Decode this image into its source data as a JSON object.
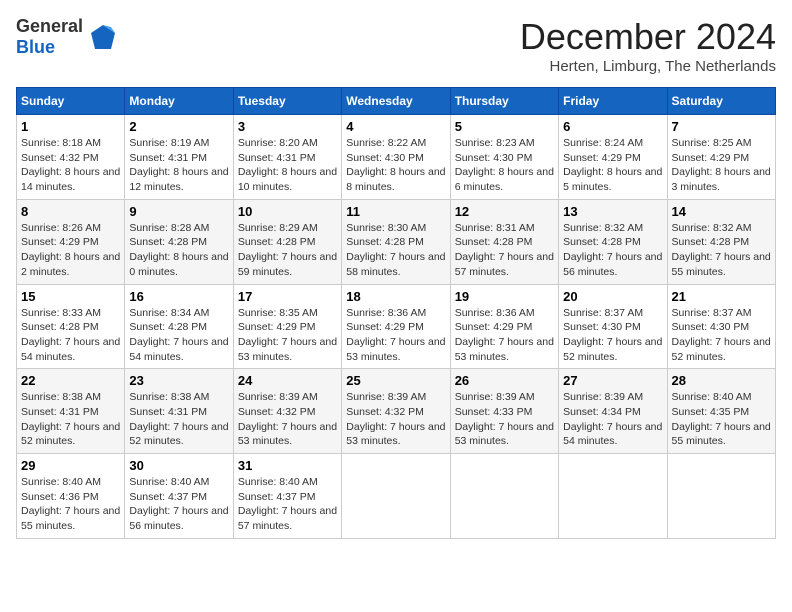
{
  "header": {
    "logo_general": "General",
    "logo_blue": "Blue",
    "month_year": "December 2024",
    "location": "Herten, Limburg, The Netherlands"
  },
  "weekdays": [
    "Sunday",
    "Monday",
    "Tuesday",
    "Wednesday",
    "Thursday",
    "Friday",
    "Saturday"
  ],
  "weeks": [
    [
      {
        "day": "1",
        "sunrise": "8:18 AM",
        "sunset": "4:32 PM",
        "daylight": "8 hours and 14 minutes."
      },
      {
        "day": "2",
        "sunrise": "8:19 AM",
        "sunset": "4:31 PM",
        "daylight": "8 hours and 12 minutes."
      },
      {
        "day": "3",
        "sunrise": "8:20 AM",
        "sunset": "4:31 PM",
        "daylight": "8 hours and 10 minutes."
      },
      {
        "day": "4",
        "sunrise": "8:22 AM",
        "sunset": "4:30 PM",
        "daylight": "8 hours and 8 minutes."
      },
      {
        "day": "5",
        "sunrise": "8:23 AM",
        "sunset": "4:30 PM",
        "daylight": "8 hours and 6 minutes."
      },
      {
        "day": "6",
        "sunrise": "8:24 AM",
        "sunset": "4:29 PM",
        "daylight": "8 hours and 5 minutes."
      },
      {
        "day": "7",
        "sunrise": "8:25 AM",
        "sunset": "4:29 PM",
        "daylight": "8 hours and 3 minutes."
      }
    ],
    [
      {
        "day": "8",
        "sunrise": "8:26 AM",
        "sunset": "4:29 PM",
        "daylight": "8 hours and 2 minutes."
      },
      {
        "day": "9",
        "sunrise": "8:28 AM",
        "sunset": "4:28 PM",
        "daylight": "8 hours and 0 minutes."
      },
      {
        "day": "10",
        "sunrise": "8:29 AM",
        "sunset": "4:28 PM",
        "daylight": "7 hours and 59 minutes."
      },
      {
        "day": "11",
        "sunrise": "8:30 AM",
        "sunset": "4:28 PM",
        "daylight": "7 hours and 58 minutes."
      },
      {
        "day": "12",
        "sunrise": "8:31 AM",
        "sunset": "4:28 PM",
        "daylight": "7 hours and 57 minutes."
      },
      {
        "day": "13",
        "sunrise": "8:32 AM",
        "sunset": "4:28 PM",
        "daylight": "7 hours and 56 minutes."
      },
      {
        "day": "14",
        "sunrise": "8:32 AM",
        "sunset": "4:28 PM",
        "daylight": "7 hours and 55 minutes."
      }
    ],
    [
      {
        "day": "15",
        "sunrise": "8:33 AM",
        "sunset": "4:28 PM",
        "daylight": "7 hours and 54 minutes."
      },
      {
        "day": "16",
        "sunrise": "8:34 AM",
        "sunset": "4:28 PM",
        "daylight": "7 hours and 54 minutes."
      },
      {
        "day": "17",
        "sunrise": "8:35 AM",
        "sunset": "4:29 PM",
        "daylight": "7 hours and 53 minutes."
      },
      {
        "day": "18",
        "sunrise": "8:36 AM",
        "sunset": "4:29 PM",
        "daylight": "7 hours and 53 minutes."
      },
      {
        "day": "19",
        "sunrise": "8:36 AM",
        "sunset": "4:29 PM",
        "daylight": "7 hours and 53 minutes."
      },
      {
        "day": "20",
        "sunrise": "8:37 AM",
        "sunset": "4:30 PM",
        "daylight": "7 hours and 52 minutes."
      },
      {
        "day": "21",
        "sunrise": "8:37 AM",
        "sunset": "4:30 PM",
        "daylight": "7 hours and 52 minutes."
      }
    ],
    [
      {
        "day": "22",
        "sunrise": "8:38 AM",
        "sunset": "4:31 PM",
        "daylight": "7 hours and 52 minutes."
      },
      {
        "day": "23",
        "sunrise": "8:38 AM",
        "sunset": "4:31 PM",
        "daylight": "7 hours and 52 minutes."
      },
      {
        "day": "24",
        "sunrise": "8:39 AM",
        "sunset": "4:32 PM",
        "daylight": "7 hours and 53 minutes."
      },
      {
        "day": "25",
        "sunrise": "8:39 AM",
        "sunset": "4:32 PM",
        "daylight": "7 hours and 53 minutes."
      },
      {
        "day": "26",
        "sunrise": "8:39 AM",
        "sunset": "4:33 PM",
        "daylight": "7 hours and 53 minutes."
      },
      {
        "day": "27",
        "sunrise": "8:39 AM",
        "sunset": "4:34 PM",
        "daylight": "7 hours and 54 minutes."
      },
      {
        "day": "28",
        "sunrise": "8:40 AM",
        "sunset": "4:35 PM",
        "daylight": "7 hours and 55 minutes."
      }
    ],
    [
      {
        "day": "29",
        "sunrise": "8:40 AM",
        "sunset": "4:36 PM",
        "daylight": "7 hours and 55 minutes."
      },
      {
        "day": "30",
        "sunrise": "8:40 AM",
        "sunset": "4:37 PM",
        "daylight": "7 hours and 56 minutes."
      },
      {
        "day": "31",
        "sunrise": "8:40 AM",
        "sunset": "4:37 PM",
        "daylight": "7 hours and 57 minutes."
      },
      null,
      null,
      null,
      null
    ]
  ]
}
